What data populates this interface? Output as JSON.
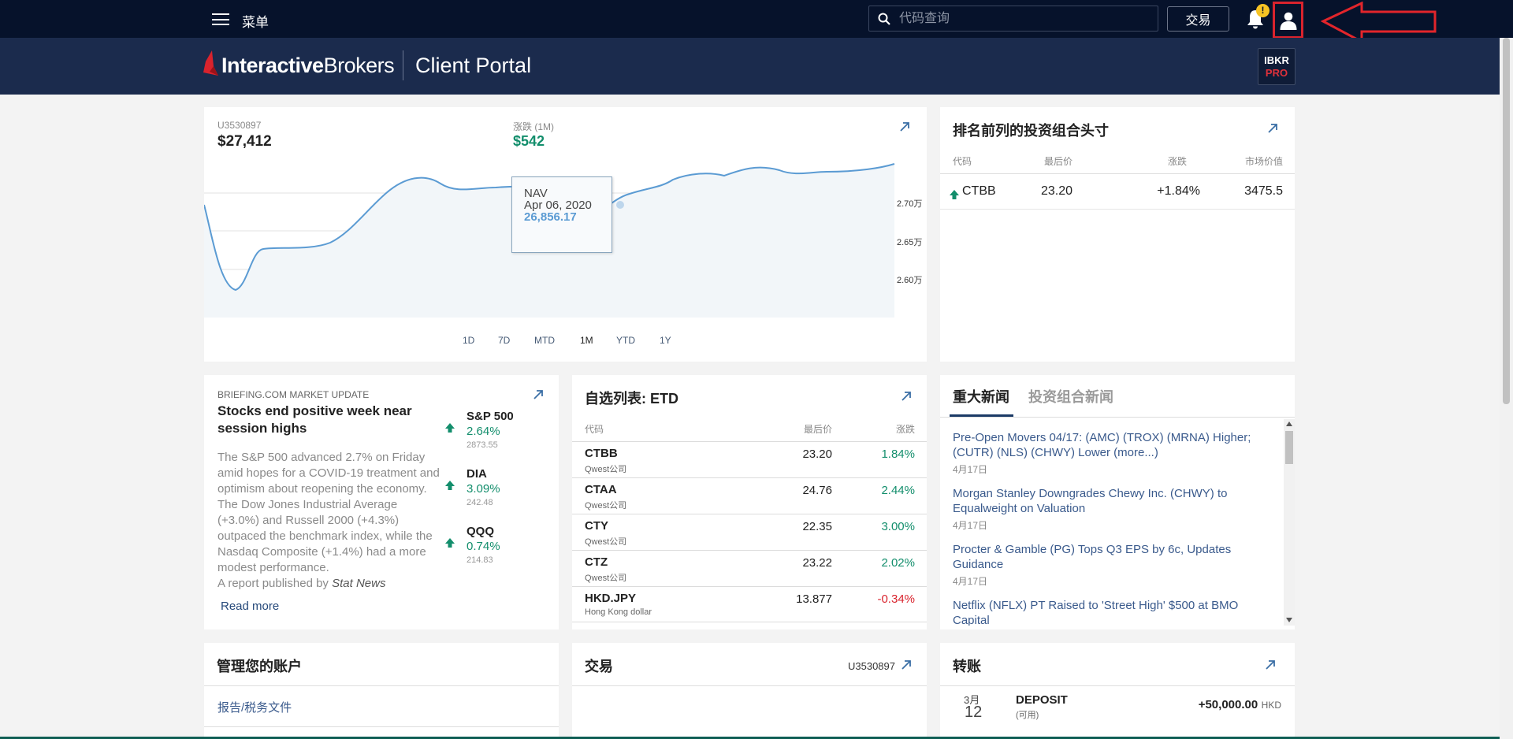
{
  "topbar": {
    "menu_label": "菜单",
    "search_placeholder": "代码查询",
    "trade_label": "交易",
    "alert_badge": "!"
  },
  "brand": {
    "logo_bold": "Interactive",
    "logo_regular": "Brokers",
    "portal_title": "Client Portal",
    "pro_line1": "IBKR",
    "pro_line2": "PRO"
  },
  "portfolio": {
    "account": "U3530897",
    "nav": "$27,412",
    "change_label": "涨跌 (1M)",
    "change": "$542",
    "y_ticks": [
      "2.70万",
      "2.65万",
      "2.60万"
    ],
    "tooltip": {
      "label": "NAV",
      "date": "Apr 06, 2020",
      "value": "26,856.17"
    },
    "ranges": [
      "1D",
      "7D",
      "MTD",
      "1M",
      "YTD",
      "1Y"
    ],
    "active_range": "1M"
  },
  "positions": {
    "title": "排名前列的投资组合头寸",
    "headers": [
      "代码",
      "最后价",
      "涨跌",
      "市场价值"
    ],
    "rows": [
      {
        "symbol": "CTBB",
        "last": "23.20",
        "change": "+1.84%",
        "value": "3475.5"
      }
    ]
  },
  "briefing": {
    "source": "BRIEFING.COM MARKET UPDATE",
    "headline": "Stocks end positive week near session highs",
    "body": "The S&P 500 advanced 2.7% on Friday amid hopes for a COVID-19 treatment and optimism about reopening the economy. The Dow Jones Industrial Average (+3.0%) and Russell 2000 (+4.3%) outpaced the benchmark index, while the Nasdaq Composite (+1.4%) had a more modest performance.",
    "report_prefix": "A report published by ",
    "report_source": "Stat News",
    "read_more": "Read more",
    "indices": [
      {
        "name": "S&P 500",
        "change": "2.64%",
        "price": "2873.55"
      },
      {
        "name": "DIA",
        "change": "3.09%",
        "price": "242.48"
      },
      {
        "name": "QQQ",
        "change": "0.74%",
        "price": "214.83"
      }
    ]
  },
  "watchlist": {
    "title": "自选列表: ETD",
    "headers": [
      "代码",
      "最后价",
      "涨跌"
    ],
    "rows": [
      {
        "symbol": "CTBB",
        "desc": "Qwest公司",
        "last": "23.20",
        "change": "1.84%",
        "dir": "up"
      },
      {
        "symbol": "CTAA",
        "desc": "Qwest公司",
        "last": "24.76",
        "change": "2.44%",
        "dir": "up"
      },
      {
        "symbol": "CTY",
        "desc": "Qwest公司",
        "last": "22.35",
        "change": "3.00%",
        "dir": "up"
      },
      {
        "symbol": "CTZ",
        "desc": "Qwest公司",
        "last": "23.22",
        "change": "2.02%",
        "dir": "up"
      },
      {
        "symbol": "HKD.JPY",
        "desc": "Hong Kong dollar",
        "last": "13.877",
        "change": "-0.34%",
        "dir": "down"
      }
    ]
  },
  "news": {
    "tabs": [
      "重大新闻",
      "投资组合新闻"
    ],
    "items": [
      {
        "headline": "Pre-Open Movers 04/17: (AMC) (TROX) (MRNA) Higher; (CUTR) (NLS) (CHWY) Lower (more...)",
        "date": "4月17日"
      },
      {
        "headline": "Morgan Stanley Downgrades Chewy Inc. (CHWY) to Equalweight on Valuation",
        "date": "4月17日"
      },
      {
        "headline": "Procter & Gamble (PG) Tops Q3 EPS by 6c, Updates Guidance",
        "date": "4月17日"
      },
      {
        "headline": "Netflix (NFLX) PT Raised to 'Street High' $500 at BMO Capital",
        "date": ""
      }
    ]
  },
  "manage": {
    "title": "管理您的账户",
    "link": "报告/税务文件"
  },
  "trade": {
    "title": "交易",
    "account": "U3530897"
  },
  "transfer": {
    "title": "转账",
    "month": "3月",
    "day": "12",
    "type": "DEPOSIT",
    "status": "(可用)",
    "amount": "+50,000.00",
    "currency": "HKD"
  },
  "colors": {
    "topbar": "#06122b",
    "brandbar": "#1b2b4d",
    "positive": "#138e6c",
    "negative": "#d9232d",
    "link": "#3a5a8c"
  }
}
